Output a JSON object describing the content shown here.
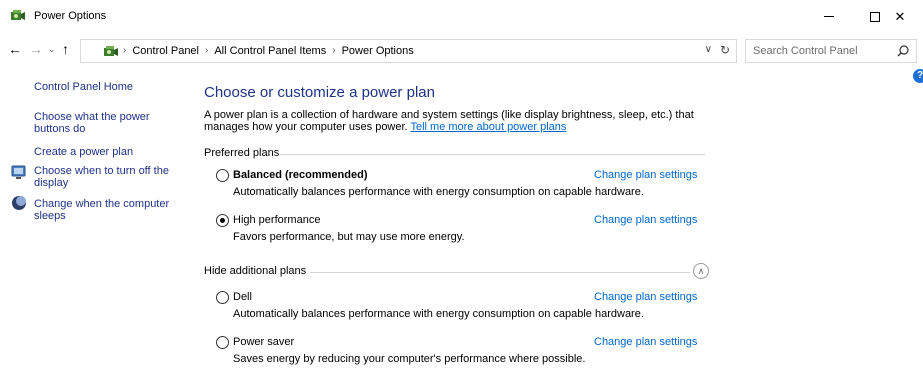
{
  "window": {
    "title": "Power Options",
    "minimize_icon": "minimize-icon",
    "maximize_icon": "maximize-icon",
    "close_label": "✕"
  },
  "nav": {
    "back": "←",
    "forward": "→",
    "recent": "⌄",
    "up": "↑",
    "breadcrumbs": [
      "Control Panel",
      "All Control Panel Items",
      "Power Options"
    ],
    "separator": "›",
    "search_placeholder": "Search Control Panel"
  },
  "sidebar": {
    "items": [
      {
        "label": "Control Panel Home"
      },
      {
        "label": "Choose what the power buttons do"
      },
      {
        "label": "Create a power plan"
      },
      {
        "label": "Choose when to turn off the display",
        "icon": "monitor-icon"
      },
      {
        "label": "Change when the computer sleeps",
        "icon": "moon-icon"
      }
    ]
  },
  "main": {
    "title": "Choose or customize a power plan",
    "description": "A power plan is a collection of hardware and system settings (like display brightness, sleep, etc.) that manages how your computer uses power.",
    "description_link": "Tell me more about power plans",
    "preferred_header": "Preferred plans",
    "additional_header": "Hide additional plans",
    "change_label": "Change plan settings",
    "plans": [
      {
        "name": "Balanced (recommended)",
        "desc": "Automatically balances performance with energy consumption on capable hardware.",
        "selected": false,
        "bold": true
      },
      {
        "name": "High performance",
        "desc": "Favors performance, but may use more energy.",
        "selected": true,
        "bold": false
      },
      {
        "name": "Dell",
        "desc": "Automatically balances performance with energy consumption on capable hardware.",
        "selected": false,
        "bold": false
      },
      {
        "name": "Power saver",
        "desc": "Saves energy by reducing your computer's performance where possible.",
        "selected": false,
        "bold": false
      }
    ]
  },
  "colors": {
    "link": "#0066cc",
    "nav_link": "#1e3287",
    "heading": "#1e3287"
  }
}
